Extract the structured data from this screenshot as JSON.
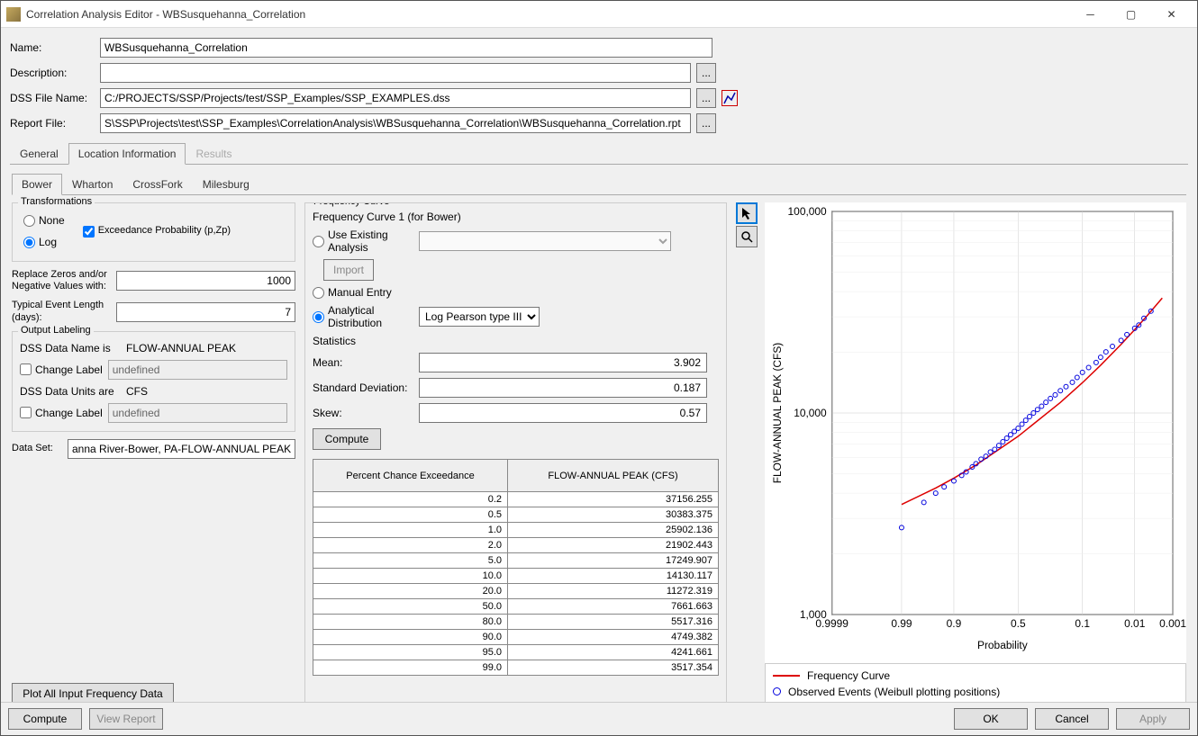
{
  "window": {
    "title": "Correlation Analysis Editor - WBSusquehanna_Correlation"
  },
  "form": {
    "name_label": "Name:",
    "name_value": "WBSusquehanna_Correlation",
    "desc_label": "Description:",
    "desc_value": "",
    "dss_label": "DSS File Name:",
    "dss_value": "C:/PROJECTS/SSP/Projects/test/SSP_Examples/SSP_EXAMPLES.dss",
    "report_label": "Report File:",
    "report_value": "S\\SSP\\Projects\\test\\SSP_Examples\\CorrelationAnalysis\\WBSusquehanna_Correlation\\WBSusquehanna_Correlation.rpt"
  },
  "main_tabs": [
    "General",
    "Location Information",
    "Results"
  ],
  "sub_tabs": [
    "Bower",
    "Wharton",
    "CrossFork",
    "Milesburg"
  ],
  "transformations": {
    "title": "Transformations",
    "none": "None",
    "log": "Log",
    "exceed": "Exceedance Probability (p,Zp)"
  },
  "replace": {
    "label": "Replace Zeros and/or Negative Values with:",
    "value": "1000"
  },
  "typical": {
    "label": "Typical Event Length (days):",
    "value": "7"
  },
  "output": {
    "title": "Output Labeling",
    "name_is": "DSS Data Name is",
    "name_val": "FLOW-ANNUAL PEAK",
    "change": "Change Label",
    "undef": "undefined",
    "units_are": "DSS Data Units are",
    "units_val": "CFS"
  },
  "dataset": {
    "label": "Data Set:",
    "value": "anna River-Bower, PA-FLOW-ANNUAL PEAK"
  },
  "plot_all_btn": "Plot All Input Frequency Data",
  "freq": {
    "title": "Frequency Curve",
    "curve1": "Frequency Curve 1 (for Bower)",
    "use_existing": "Use Existing Analysis",
    "import_btn": "Import",
    "manual": "Manual Entry",
    "analytical": "Analytical Distribution",
    "dist": "Log Pearson type III",
    "stats": "Statistics",
    "mean_label": "Mean:",
    "mean": "3.902",
    "std_label": "Standard Deviation:",
    "std": "0.187",
    "skew_label": "Skew:",
    "skew": "0.57",
    "compute": "Compute",
    "col1": "Percent Chance Exceedance",
    "col2": "FLOW-ANNUAL PEAK (CFS)",
    "rows": [
      [
        "0.2",
        "37156.255"
      ],
      [
        "0.5",
        "30383.375"
      ],
      [
        "1.0",
        "25902.136"
      ],
      [
        "2.0",
        "21902.443"
      ],
      [
        "5.0",
        "17249.907"
      ],
      [
        "10.0",
        "14130.117"
      ],
      [
        "20.0",
        "11272.319"
      ],
      [
        "50.0",
        "7661.663"
      ],
      [
        "80.0",
        "5517.316"
      ],
      [
        "90.0",
        "4749.382"
      ],
      [
        "95.0",
        "4241.661"
      ],
      [
        "99.0",
        "3517.354"
      ]
    ]
  },
  "chart": {
    "ylabel": "FLOW-ANNUAL PEAK (CFS)",
    "xlabel": "Probability",
    "yticks": [
      "100,000",
      "10,000",
      "1,000"
    ],
    "xticks": [
      "0.9999",
      "0.99",
      "0.9",
      "0.5",
      "0.1",
      "0.01",
      "0.001"
    ],
    "legend1": "Frequency Curve",
    "legend2": "Observed Events (Weibull plotting positions)"
  },
  "chart_data": {
    "type": "line",
    "title": "",
    "xlabel": "Probability",
    "ylabel": "FLOW-ANNUAL PEAK (CFS)",
    "x_scale": "probability",
    "y_scale": "log",
    "ylim": [
      1000,
      100000
    ],
    "xticks": [
      0.9999,
      0.99,
      0.9,
      0.5,
      0.1,
      0.01,
      0.001
    ],
    "series": [
      {
        "name": "Frequency Curve",
        "x": [
          0.99,
          0.95,
          0.9,
          0.8,
          0.5,
          0.2,
          0.1,
          0.05,
          0.02,
          0.01,
          0.005,
          0.002
        ],
        "y": [
          3517,
          4242,
          4749,
          5517,
          7662,
          11272,
          14130,
          17250,
          21902,
          25902,
          30383,
          37156
        ]
      },
      {
        "name": "Observed Events (Weibull plotting positions)",
        "type": "scatter",
        "x": [
          0.99,
          0.97,
          0.95,
          0.93,
          0.9,
          0.87,
          0.85,
          0.82,
          0.8,
          0.77,
          0.74,
          0.71,
          0.68,
          0.65,
          0.62,
          0.59,
          0.56,
          0.53,
          0.5,
          0.47,
          0.44,
          0.41,
          0.38,
          0.35,
          0.32,
          0.29,
          0.26,
          0.23,
          0.2,
          0.17,
          0.14,
          0.12,
          0.1,
          0.08,
          0.06,
          0.05,
          0.04,
          0.03,
          0.02,
          0.015,
          0.01,
          0.008,
          0.006,
          0.004
        ],
        "y": [
          2700,
          3600,
          4000,
          4300,
          4600,
          4900,
          5100,
          5400,
          5600,
          5900,
          6100,
          6400,
          6600,
          6900,
          7200,
          7500,
          7800,
          8100,
          8400,
          8800,
          9200,
          9600,
          10000,
          10400,
          10800,
          11300,
          11800,
          12300,
          12900,
          13500,
          14200,
          15000,
          15900,
          16800,
          17800,
          18900,
          20100,
          21400,
          22900,
          24500,
          26300,
          27300,
          29500,
          32000
        ]
      }
    ]
  },
  "bottom": {
    "compute": "Compute",
    "view_report": "View Report",
    "ok": "OK",
    "cancel": "Cancel",
    "apply": "Apply"
  }
}
